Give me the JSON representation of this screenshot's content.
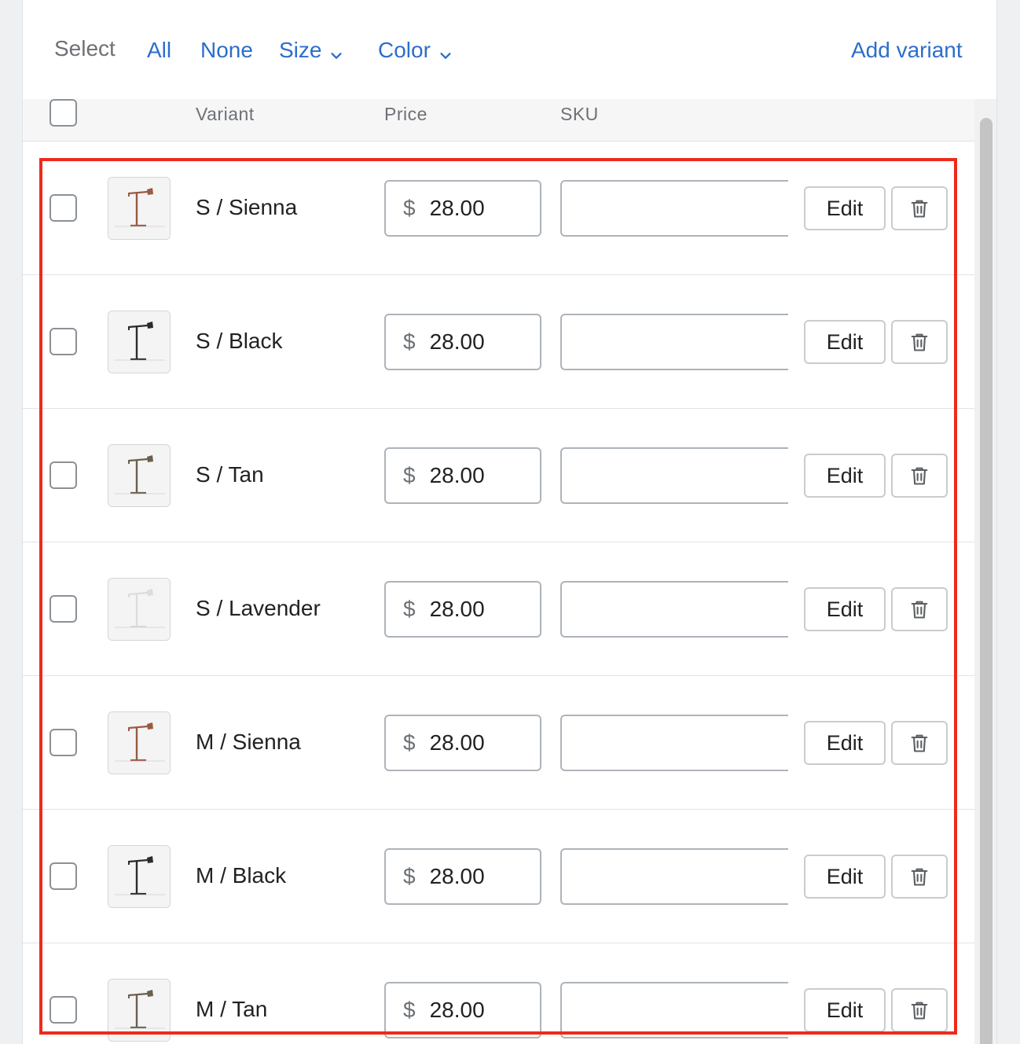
{
  "toolbar": {
    "select_label": "Select",
    "all_label": "All",
    "none_label": "None",
    "size_label": "Size",
    "color_label": "Color",
    "add_variant_label": "Add variant"
  },
  "table": {
    "headers": {
      "variant": "Variant",
      "price": "Price",
      "sku": "SKU"
    },
    "edit_label": "Edit",
    "rows": [
      {
        "name": "S / Sienna",
        "currency": "$",
        "price": "28.00",
        "sku": "",
        "color": "#9a5a43"
      },
      {
        "name": "S / Black",
        "currency": "$",
        "price": "28.00",
        "sku": "",
        "color": "#2b2b2b"
      },
      {
        "name": "S / Tan",
        "currency": "$",
        "price": "28.00",
        "sku": "",
        "color": "#6b5f4f"
      },
      {
        "name": "S / Lavender",
        "currency": "$",
        "price": "28.00",
        "sku": "",
        "color": "#dcdcdc"
      },
      {
        "name": "M / Sienna",
        "currency": "$",
        "price": "28.00",
        "sku": "",
        "color": "#9a5a43"
      },
      {
        "name": "M / Black",
        "currency": "$",
        "price": "28.00",
        "sku": "",
        "color": "#2b2b2b"
      },
      {
        "name": "M / Tan",
        "currency": "$",
        "price": "28.00",
        "sku": "",
        "color": "#6b5f4f"
      }
    ]
  },
  "colors": {
    "link": "#2c6ecb",
    "highlight": "#ee2a1b"
  },
  "icons": {
    "chevron": "chevron-down-icon",
    "delete": "trash-icon",
    "thumbnail": "desk-lamp-icon"
  }
}
